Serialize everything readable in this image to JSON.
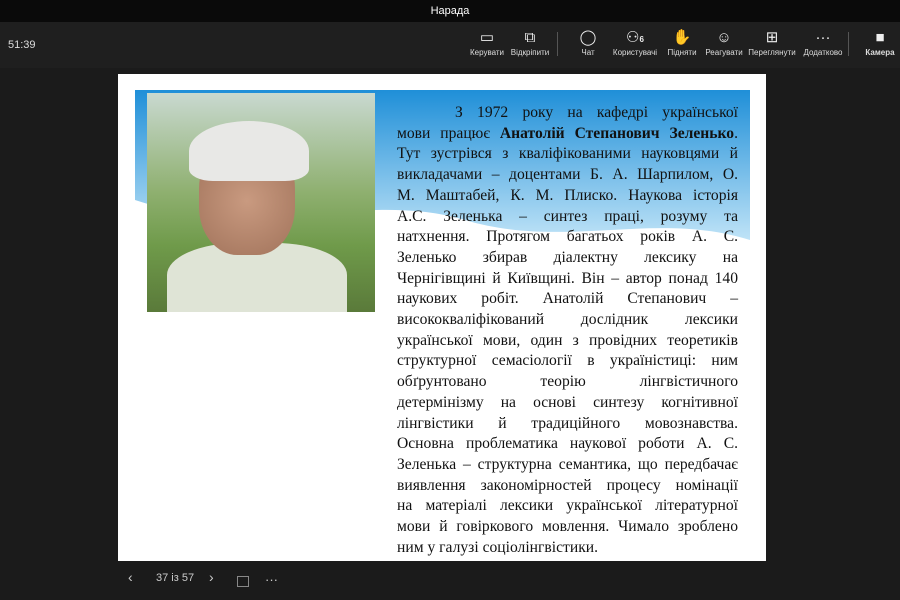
{
  "window": {
    "title": "Нарада"
  },
  "toolbar": {
    "timer": "51:39",
    "buttons": [
      {
        "label": "Керувати",
        "icon": "share-screen-icon"
      },
      {
        "label": "Відкріпити",
        "icon": "popout-icon"
      },
      {
        "label": "Чат",
        "icon": "chat-icon"
      },
      {
        "label": "Користувачі",
        "icon": "people-icon",
        "badge": "6"
      },
      {
        "label": "Підняти",
        "icon": "raise-hand-icon"
      },
      {
        "label": "Реагувати",
        "icon": "smile-icon"
      },
      {
        "label": "Переглянути",
        "icon": "grid-icon"
      },
      {
        "label": "Додатково",
        "icon": "more-icon"
      },
      {
        "label": "Камера",
        "icon": "camera-icon"
      }
    ]
  },
  "slide": {
    "lines": [
      "З 1972 року на кафедрі української",
      "мови працює |Анатолій Степанович Зеленько|.",
      "Тут зустрівся з кваліфікованими науковцями й",
      "викладачами – доцентами Б. А. Шарпилом, О.",
      "М. Маштабей, К. М. Плиско. Наукова історія",
      "А.С. Зеленька – синтез праці, розуму та",
      "натхнення. Протягом багатьох років А. С.",
      "Зеленько збирав діалектну лексику на",
      "Чернігівщині й Київщині. Він – автор понад 140",
      "наукових робіт. Анатолій Степанович –",
      "висококваліфікований дослідник лексики",
      "української мови, один з провідних теоретиків",
      "структурної семасіології в україністиці: ним",
      "обґрунтовано теорію лінгвістичного",
      "детермінізму на основі синтезу когнітивної",
      "лінгвістики й традиційного мовознавства.",
      "Основна проблематика наукової роботи А. С.",
      "Зеленька – структурна семантика, що передбачає",
      "виявлення закономірностей процесу номінації",
      "на матеріалі лексики української літературної",
      "мови й говіркового мовлення. Чимало зроблено",
      "ним у галузі соціолінгвістики."
    ]
  },
  "navigation": {
    "page": "37 із 57",
    "prev": "‹",
    "next": "›",
    "more": "···"
  }
}
